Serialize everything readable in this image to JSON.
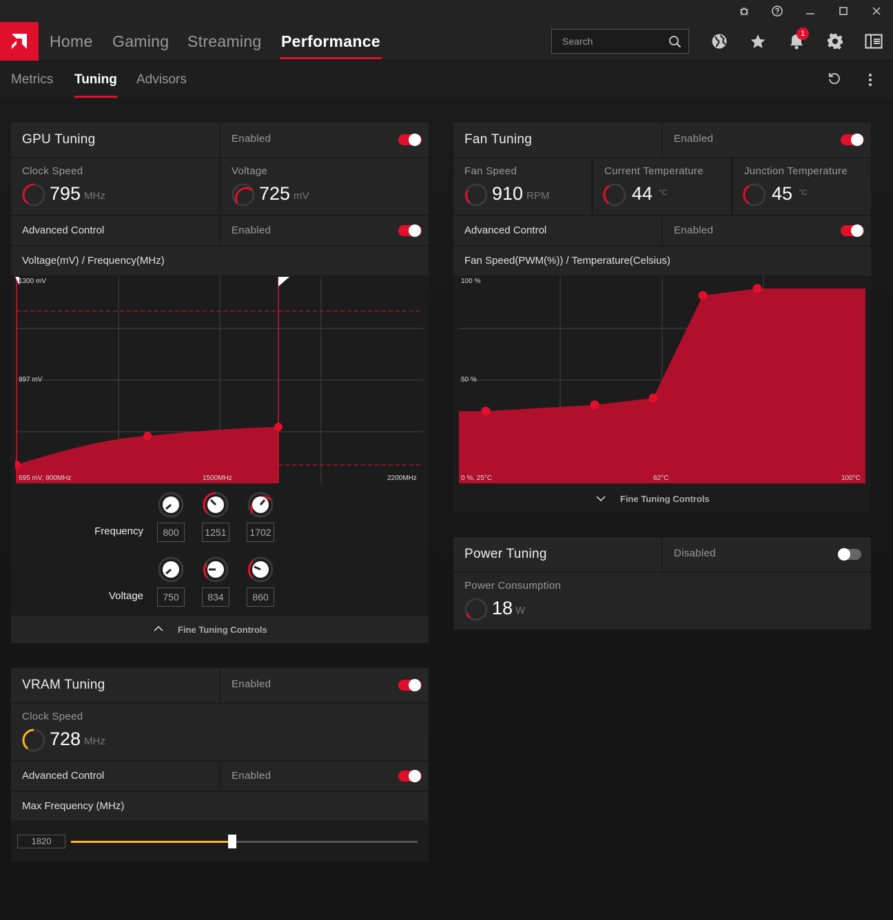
{
  "titlebar": {
    "icons": [
      "bug-icon",
      "help-icon",
      "minimize-icon",
      "maximize-icon",
      "close-icon"
    ]
  },
  "nav": {
    "tabs": [
      "Home",
      "Gaming",
      "Streaming",
      "Performance"
    ],
    "active_tab": "Performance",
    "search_placeholder": "Search",
    "notifications_count": "1",
    "icons": [
      "globe-icon",
      "star-icon",
      "bell-icon",
      "gear-icon",
      "sidebar-icon"
    ]
  },
  "subnav": {
    "tabs": [
      "Metrics",
      "Tuning",
      "Advisors"
    ],
    "active_tab": "Tuning"
  },
  "gpu": {
    "title": "GPU Tuning",
    "status": "Enabled",
    "enabled": true,
    "clock_label": "Clock Speed",
    "clock_value": "795",
    "clock_unit": "MHz",
    "voltage_label": "Voltage",
    "voltage_value": "725",
    "voltage_unit": "mV",
    "adv_label": "Advanced Control",
    "adv_status": "Enabled",
    "chart_title": "Voltage(mV) / Frequency(MHz)",
    "chart": {
      "y_top": "1300 mV",
      "y_mid": "997 mV",
      "origin": "695 mV, 800MHz",
      "x_mid": "1500MHz",
      "x_max": "2200MHz"
    },
    "freq_label": "Frequency",
    "freq_values": [
      "800",
      "1251",
      "1702"
    ],
    "volt_label": "Voltage",
    "volt_values": [
      "750",
      "834",
      "860"
    ],
    "fine_tuning": "Fine Tuning Controls"
  },
  "fan": {
    "title": "Fan Tuning",
    "status": "Enabled",
    "enabled": true,
    "speed_label": "Fan Speed",
    "speed_value": "910",
    "speed_unit": "RPM",
    "temp_label": "Current Temperature",
    "temp_value": "44",
    "temp_unit": "°C",
    "jtemp_label": "Junction Temperature",
    "jtemp_value": "45",
    "jtemp_unit": "°C",
    "adv_label": "Advanced Control",
    "adv_status": "Enabled",
    "chart_title": "Fan Speed(PWM(%)) / Temperature(Celsius)",
    "chart": {
      "y_top": "100 %",
      "y_mid": "50 %",
      "origin": "0 %, 25°C",
      "x_mid": "62°C",
      "x_max": "100°C"
    },
    "fine_tuning": "Fine Tuning Controls"
  },
  "power": {
    "title": "Power Tuning",
    "status": "Disabled",
    "enabled": false,
    "consumption_label": "Power Consumption",
    "consumption_value": "18",
    "consumption_unit": "W"
  },
  "vram": {
    "title": "VRAM Tuning",
    "status": "Enabled",
    "enabled": true,
    "clock_label": "Clock Speed",
    "clock_value": "728",
    "clock_unit": "MHz",
    "adv_label": "Advanced Control",
    "adv_status": "Enabled",
    "max_freq_label": "Max Frequency (MHz)",
    "max_freq_value": "1820",
    "slider_fraction": 0.466
  },
  "colors": {
    "accent": "#e0102c",
    "vram_accent": "#f5b820",
    "panel": "#1c1c1c"
  }
}
